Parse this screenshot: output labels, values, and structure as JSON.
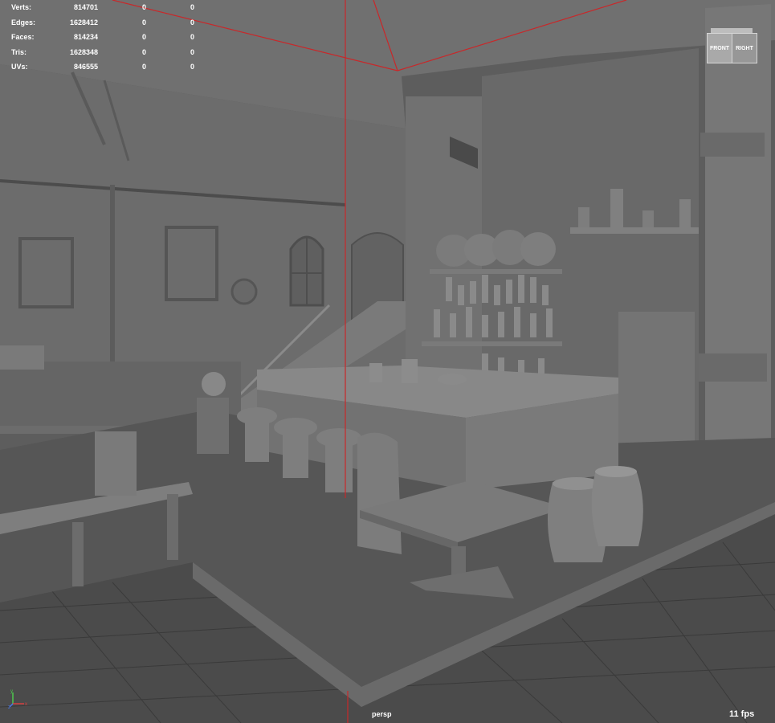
{
  "stats": [
    {
      "label": "Verts:",
      "total": "814701",
      "selected": "0",
      "component": "0"
    },
    {
      "label": "Edges:",
      "total": "1628412",
      "selected": "0",
      "component": "0"
    },
    {
      "label": "Faces:",
      "total": "814234",
      "selected": "0",
      "component": "0"
    },
    {
      "label": "Tris:",
      "total": "1628348",
      "selected": "0",
      "component": "0"
    },
    {
      "label": "UVs:",
      "total": "846555",
      "selected": "0",
      "component": "0"
    }
  ],
  "viewcube": {
    "front": "FRONT",
    "right": "RIGHT"
  },
  "camera": "persp",
  "fps": "11 fps",
  "axis": {
    "x": "x",
    "y": "y",
    "z": "z"
  },
  "colors": {
    "background": "#5d5d5d",
    "wall": "#6e6e6e",
    "floor": "#4b4b4b",
    "grid": "#3b3b3b",
    "camera_line": "#c8282a",
    "hud_text": "#ffffff"
  }
}
